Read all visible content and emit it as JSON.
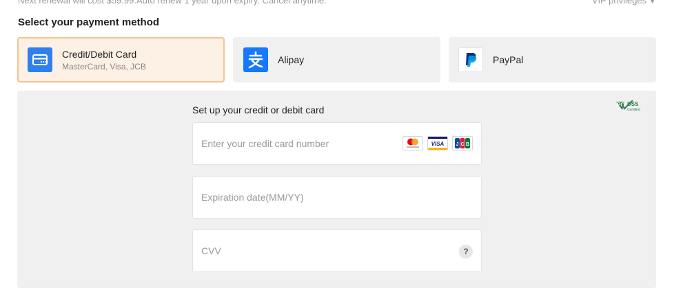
{
  "header": {
    "renewal_note": "Next renewal will cost $59.99.Auto renew 1 year upon expiry. Cancel anytime.",
    "vip_link": "VIP privileges"
  },
  "payment": {
    "title": "Select your payment method",
    "methods": [
      {
        "label": "Credit/Debit Card",
        "sublabel": "MasterCard, Visa, JCB",
        "icon": "credit-card-icon",
        "selected": true
      },
      {
        "label": "Alipay",
        "icon": "alipay-icon",
        "selected": false
      },
      {
        "label": "PayPal",
        "icon": "paypal-icon",
        "selected": false
      }
    ]
  },
  "card_form": {
    "title": "Set up your credit or debit card",
    "card_number_placeholder": "Enter your credit card number",
    "expiration_placeholder": "Expiration date(MM/YY)",
    "cvv_placeholder": "CVV",
    "help_symbol": "?",
    "accepted_brands": [
      "mastercard",
      "VISA",
      "JCB"
    ],
    "certification_badge": "PCI DSS Certified"
  },
  "colors": {
    "selected_bg": "#fdf0e4",
    "selected_border": "#f7c28f",
    "card_icon": "#2f80ed",
    "alipay": "#1677ff",
    "paypal_dark": "#003087",
    "paypal_light": "#009cde",
    "panel_bg": "#f0f0f0"
  }
}
